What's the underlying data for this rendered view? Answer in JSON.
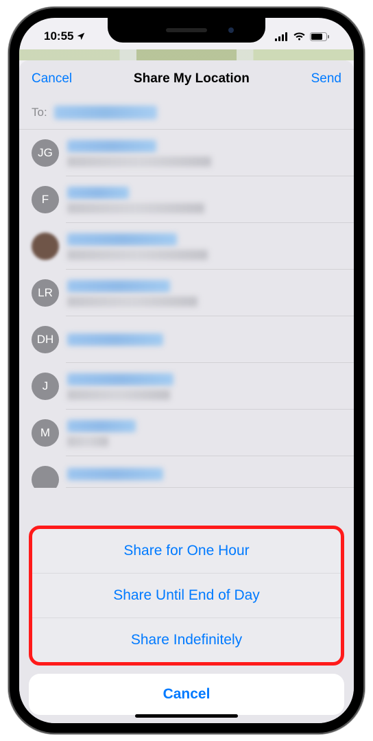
{
  "status": {
    "time": "10:55"
  },
  "nav": {
    "cancel": "Cancel",
    "title": "Share My Location",
    "send": "Send"
  },
  "to": {
    "label": "To:"
  },
  "contacts": [
    {
      "initials": "JG",
      "photo": false,
      "name_w": 130,
      "sub_w": 210
    },
    {
      "initials": "F",
      "photo": false,
      "name_w": 90,
      "sub_w": 200
    },
    {
      "initials": "",
      "photo": true,
      "name_w": 160,
      "sub_w": 205
    },
    {
      "initials": "LR",
      "photo": false,
      "name_w": 150,
      "sub_w": 190
    },
    {
      "initials": "DH",
      "photo": false,
      "name_w": 140,
      "sub_w": 0
    },
    {
      "initials": "J",
      "photo": false,
      "name_w": 155,
      "sub_w": 150
    },
    {
      "initials": "M",
      "photo": false,
      "name_w": 100,
      "sub_w": 60
    }
  ],
  "last_partial_name_w": 140,
  "sheet": {
    "options": [
      "Share for One Hour",
      "Share Until End of Day",
      "Share Indefinitely"
    ],
    "cancel": "Cancel"
  }
}
